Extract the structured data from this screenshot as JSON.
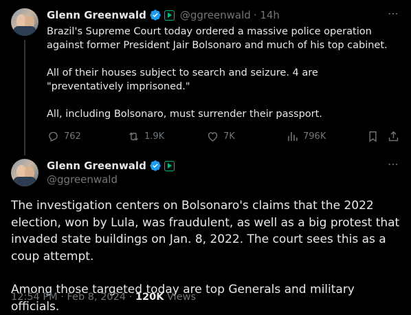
{
  "tweet1": {
    "name": "Glenn Greenwald",
    "handle": "@ggreenwald",
    "time": "· 14h",
    "paragraphs": [
      "Brazil's Supreme Court today ordered a massive police operation against former President Jair Bolsonaro and much of his top cabinet.",
      "All of their houses subject to search and seizure. 4 are \"preventatively imprisoned.\"",
      "All, including Bolsonaro, must surrender their passport."
    ],
    "replies": "762",
    "reposts": "1.9K",
    "likes": "7K",
    "views": "796K"
  },
  "tweet2": {
    "name": "Glenn Greenwald",
    "handle": "@ggreenwald",
    "paragraphs": [
      "The investigation centers on Bolsonaro's claims that the 2022 election, won by Lula, was fraudulent, as well as a big protest that invaded state buildings on Jan. 8, 2022. The court sees this as a coup attempt.",
      "Among those targeted today are top Generals and military officials."
    ],
    "timestamp": "12:54 PM · Feb 8, 2024 · ",
    "views_count": "120K",
    "views_label": " Views"
  },
  "colors": {
    "background": "#000000",
    "text": "#e7e9ea",
    "muted": "#71767b",
    "verified": "#1d9bf0",
    "media_badge": "#00ba7c"
  }
}
